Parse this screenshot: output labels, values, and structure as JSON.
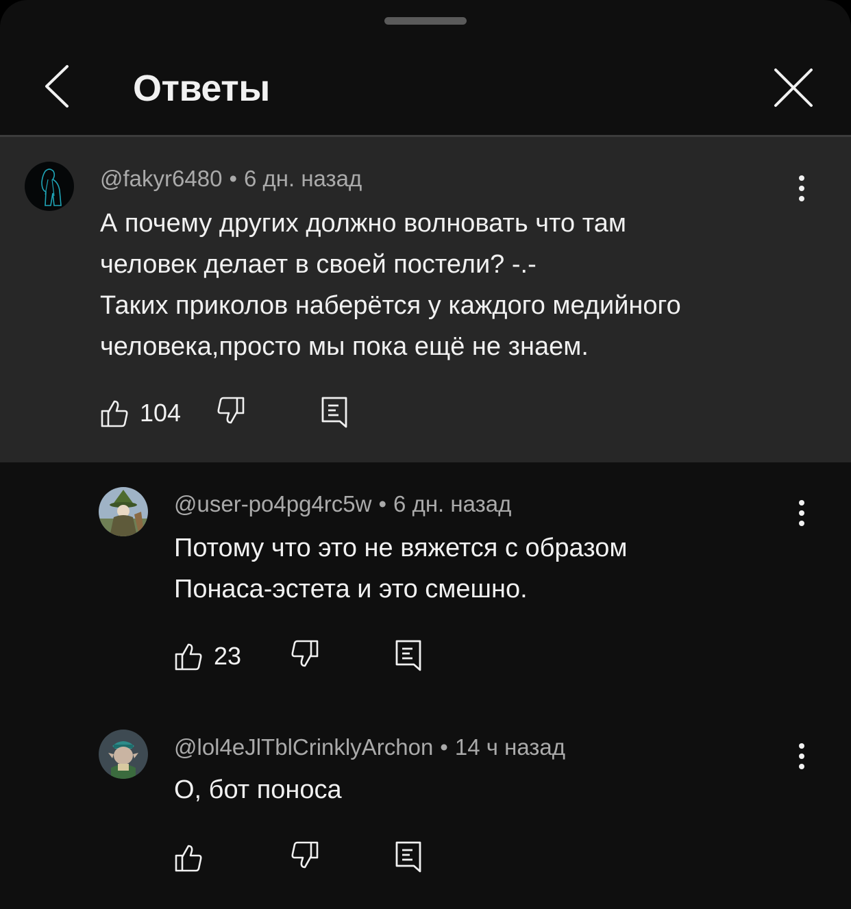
{
  "header": {
    "title": "Ответы"
  },
  "parent": {
    "author": "@fakyr6480",
    "separator": "•",
    "time": "6 дн. назад",
    "text_lines": [
      "А почему других должно волновать что там",
      "человек делает в своей постели? -.-",
      "Таких приколов наберётся у каждого медийного",
      "человека,просто мы пока ещё не знаем."
    ],
    "likes": "104"
  },
  "replies": [
    {
      "author": "@user-po4pg4rc5w",
      "separator": "•",
      "time": "6 дн. назад",
      "text_lines": [
        "Потому что это не вяжется с образом",
        "Понаса-эстета и это смешно."
      ],
      "likes": "23"
    },
    {
      "author": "@lol4eJlTblCrinklyArchon",
      "separator": "•",
      "time": "14 ч назад",
      "text_lines": [
        "О, бот поноса"
      ],
      "likes": ""
    }
  ],
  "icons": {
    "back": "chevron-left-icon",
    "close": "close-icon",
    "more": "more-vertical-icon",
    "like": "thumb-up-icon",
    "dislike": "thumb-down-icon",
    "reply": "reply-comment-icon"
  },
  "colors": {
    "background": "#0f0f0f",
    "highlight": "#272727",
    "primary_text": "#f1f1f1",
    "secondary_text": "#aaaaaa"
  }
}
